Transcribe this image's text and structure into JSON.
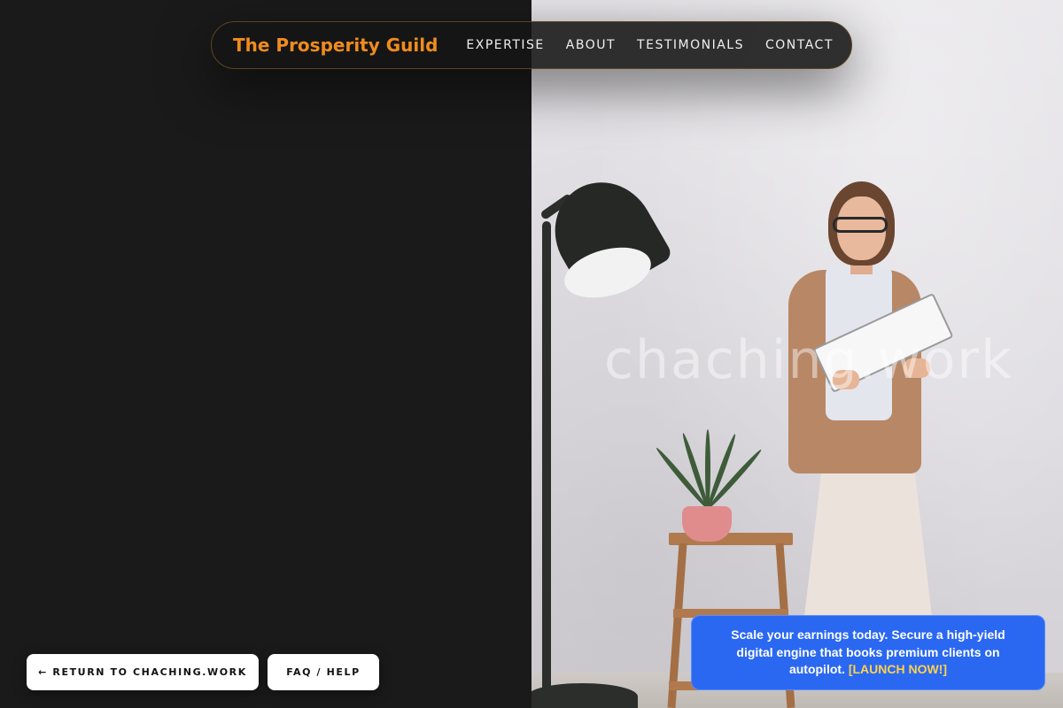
{
  "navbar": {
    "brand": "The Prosperity Guild",
    "links": [
      "EXPERTISE",
      "ABOUT",
      "TESTIMONIALS",
      "CONTACT"
    ]
  },
  "hero": {
    "watermark": "chaching.work"
  },
  "buttons": {
    "return_label": "← RETURN TO CHACHING.WORK",
    "faq_label": "FAQ / HELP"
  },
  "promo": {
    "text": "Scale your earnings today. Secure a high-yield digital engine that books premium clients on autopilot.",
    "link_label": "[LAUNCH NOW!]"
  },
  "colors": {
    "background": "#1a1a1a",
    "brand_accent": "#f08c1e",
    "promo_bg": "#2a68f2",
    "promo_link": "#ffd24a"
  }
}
